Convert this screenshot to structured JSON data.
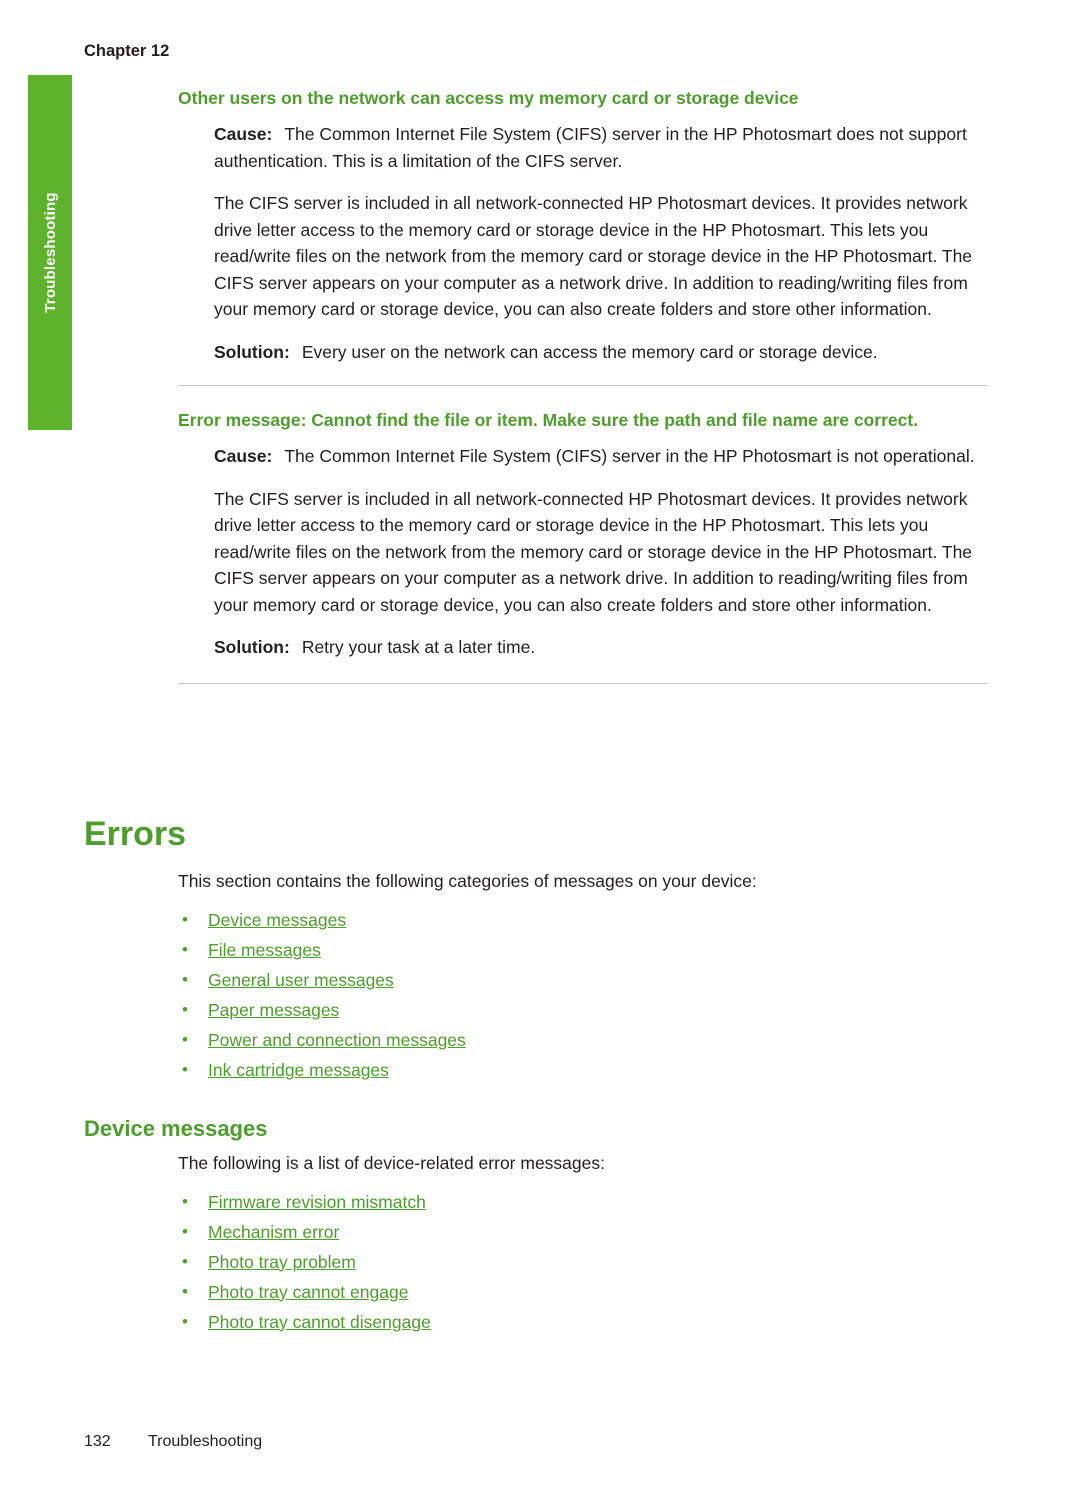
{
  "chapter": "Chapter 12",
  "side_tab": "Troubleshooting",
  "sections": [
    {
      "heading": "Other users on the network can access my memory card or storage device",
      "cause_label": "Cause:",
      "cause_text": "The Common Internet File System (CIFS) server in the HP Photosmart does not support authentication. This is a limitation of the CIFS server.",
      "body": "The CIFS server is included in all network-connected HP Photosmart devices. It provides network drive letter access to the memory card or storage device in the HP Photosmart. This lets you read/write files on the network from the memory card or storage device in the HP Photosmart. The CIFS server appears on your computer as a network drive. In addition to reading/writing files from your memory card or storage device, you can also create folders and store other information.",
      "solution_label": "Solution:",
      "solution_text": "Every user on the network can access the memory card or storage device."
    },
    {
      "heading": "Error message: Cannot find the file or item. Make sure the path and file name are correct.",
      "cause_label": "Cause:",
      "cause_text": "The Common Internet File System (CIFS) server in the HP Photosmart is not operational.",
      "body": "The CIFS server is included in all network-connected HP Photosmart devices. It provides network drive letter access to the memory card or storage device in the HP Photosmart. This lets you read/write files on the network from the memory card or storage device in the HP Photosmart. The CIFS server appears on your computer as a network drive. In addition to reading/writing files from your memory card or storage device, you can also create folders and store other information.",
      "solution_label": "Solution:",
      "solution_text": "Retry your task at a later time."
    }
  ],
  "errors": {
    "title": "Errors",
    "intro": "This section contains the following categories of messages on your device:",
    "links": [
      "Device messages",
      "File messages",
      "General user messages",
      "Paper messages",
      "Power and connection messages",
      "Ink cartridge messages"
    ]
  },
  "device_messages": {
    "title": "Device messages",
    "intro": "The following is a list of device-related error messages:",
    "links": [
      "Firmware revision mismatch",
      "Mechanism error",
      "Photo tray problem",
      "Photo tray cannot engage",
      "Photo tray cannot disengage"
    ]
  },
  "footer": {
    "page_number": "132",
    "label": "Troubleshooting"
  },
  "colors": {
    "accent_green": "#4e9d2d",
    "tab_green": "#5fb22b",
    "body_text": "#231f20"
  }
}
